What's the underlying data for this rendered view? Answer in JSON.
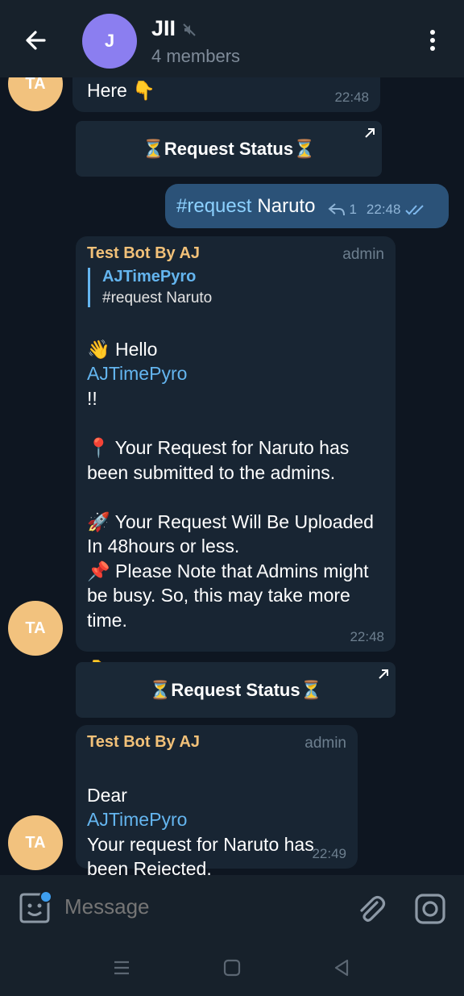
{
  "header": {
    "avatar_letter": "J",
    "title": "JII",
    "subtitle": "4 members",
    "back_icon": "arrow-left-icon",
    "mute_icon": "mute-icon",
    "menu_icon": "more-vertical-icon"
  },
  "messages": {
    "top_fragment": {
      "avatar": "TA",
      "text": "Here 👇",
      "time": "22:48"
    },
    "button1": {
      "label": "⏳Request Status⏳"
    },
    "outgoing": {
      "hashtag": "#request",
      "text": "Naruto",
      "replies": "1",
      "time": "22:48"
    },
    "bot1": {
      "sender": "Test Bot By AJ",
      "role": "admin",
      "reply_name": "AJTimePyro",
      "reply_text": "#request Naruto",
      "hello_prefix": "👋 Hello",
      "hello_user": "AJTimePyro",
      "hello_suffix": "!!",
      "body": "📍 Your Request for Naruto has been submitted to the admins.\n\n🚀 Your Request Will Be Uploaded In 48hours or less.\n📌 Please Note that Admins might be busy. So, this may take more time.\n\n👇 See Your Request Status Here 👇",
      "time": "22:48",
      "avatar": "TA"
    },
    "button2": {
      "label": "⏳Request Status⏳"
    },
    "bot2": {
      "sender": "Test Bot By AJ",
      "role": "admin",
      "dear": "Dear",
      "user": "AJTimePyro",
      "body": "Your request for Naruto has been Rejected.\nThanks for requesting!",
      "time": "22:49",
      "avatar": "TA"
    }
  },
  "input": {
    "placeholder": "Message"
  },
  "colors": {
    "background": "#0e1621",
    "header": "#17212b",
    "incoming_bubble": "#182533",
    "outgoing_bubble": "#2b5278",
    "sender_name": "#f2c179",
    "link": "#64b5ef",
    "avatar_ta": "#f2c27e",
    "avatar_j": "#8b7ef0"
  }
}
